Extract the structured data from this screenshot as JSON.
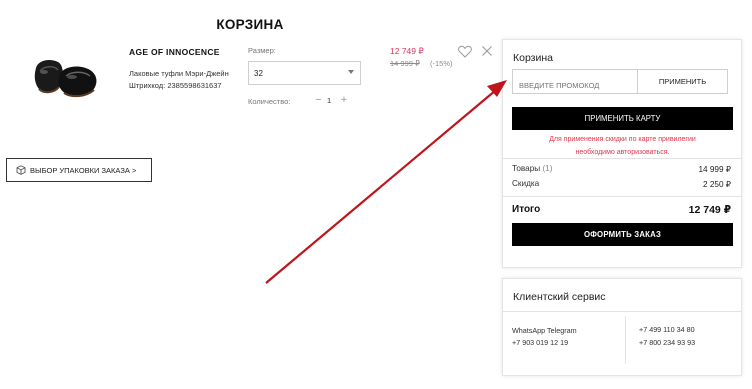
{
  "page": {
    "title": "КОРЗИНА"
  },
  "product": {
    "brand": "AGE OF INNOCENCE",
    "name": "Лаковые туфли Мэри-Джейн",
    "sku": "Штрихкод: 2385598631637",
    "size_label": "Размер:",
    "size_value": "32",
    "quantity_label": "Количество:",
    "quantity_minus": "−",
    "quantity_value": "1",
    "quantity_plus": "+",
    "price_new": "12 749 ₽",
    "price_old": "14 999 ₽",
    "discount": "(-15%)",
    "icons": {
      "wishlist": "heart-icon",
      "remove": "close-icon",
      "image": "shoes-icon"
    }
  },
  "packaging": {
    "label": "ВЫБОР УПАКОВКИ ЗАКАЗА >",
    "icon": "box-icon"
  },
  "summary": {
    "title": "Корзина",
    "promo_placeholder": "ВВЕДИТЕ ПРОМОКОД",
    "promo_button": "ПРИМЕНИТЬ",
    "apply_card_button": "ПРИМЕНИТЬ КАРТУ",
    "card_note_line1": "Для применения скидки по карте привилегии",
    "card_note_line2": "необходимо авторизоваться.",
    "goods_label": "Товары",
    "goods_count": "(1)",
    "goods_value": "14 999 ₽",
    "discount_label": "Скидка",
    "discount_value": "2 250 ₽",
    "total_label": "Итого",
    "total_value": "12 749 ₽",
    "checkout_button": "ОФОРМИТЬ ЗАКАЗ"
  },
  "service": {
    "title": "Клиентский сервис",
    "messengers": "WhatsApp Telegram",
    "phone1": "+7 903 019 12 19",
    "phone2": "+7 499 110 34 80",
    "phone3": "+7 800 234 93 93"
  },
  "colors": {
    "price_accent": "#d8365a",
    "note_red": "#e2374c",
    "arrow": "#c0141c",
    "button_dark": "#000000"
  }
}
